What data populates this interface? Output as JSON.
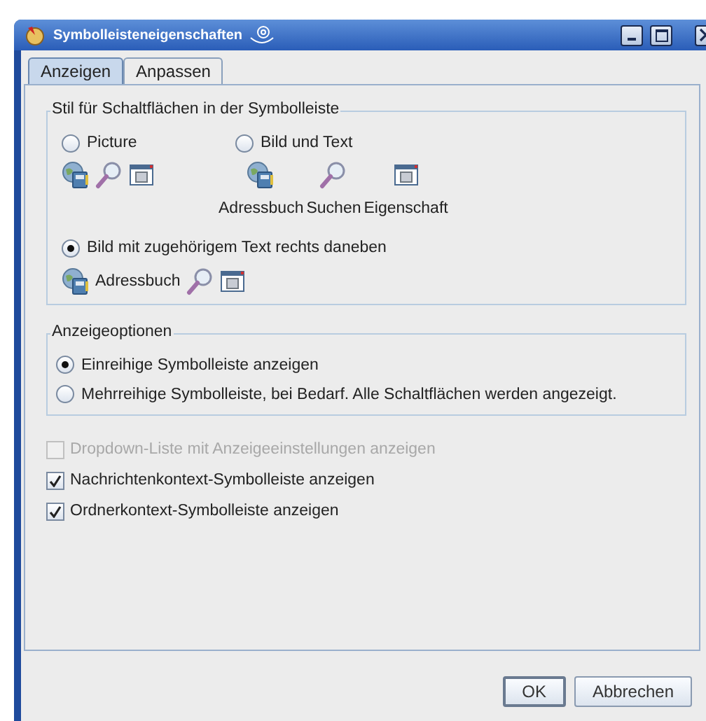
{
  "window": {
    "title": "Symbolleisteneigenschaften"
  },
  "tabs": [
    {
      "label": "Anzeigen",
      "selected": true
    },
    {
      "label": "Anpassen",
      "selected": false
    }
  ],
  "button_style": {
    "title": "Stil für Schaltflächen in der Symbolleiste",
    "options": [
      {
        "label": "Picture",
        "selected": false
      },
      {
        "label": "Bild und Text",
        "selected": false
      },
      {
        "label": "Bild mit zugehörigem Text rechts daneben",
        "selected": true
      }
    ],
    "preview_labels": [
      "Adressbuch",
      "Suchen",
      "Eigenschaft"
    ],
    "side_label": "Adressbuch"
  },
  "display_options": {
    "title": "Anzeigeoptionen",
    "options": [
      {
        "label": "Einreihige Symbolleiste anzeigen",
        "selected": true
      },
      {
        "label": "Mehrreihige Symbolleiste, bei Bedarf. Alle Schaltflächen werden angezeigt.",
        "selected": false
      }
    ]
  },
  "checkboxes": [
    {
      "label": "Dropdown-Liste mit Anzeigeeinstellungen anzeigen",
      "checked": false,
      "disabled": true
    },
    {
      "label": "Nachrichtenkontext-Symbolleiste anzeigen",
      "checked": true,
      "disabled": false
    },
    {
      "label": "Ordnerkontext-Symbolleiste anzeigen",
      "checked": true,
      "disabled": false
    }
  ],
  "buttons": [
    {
      "label": "OK",
      "default": true
    },
    {
      "label": "Abbrechen",
      "default": false
    }
  ]
}
